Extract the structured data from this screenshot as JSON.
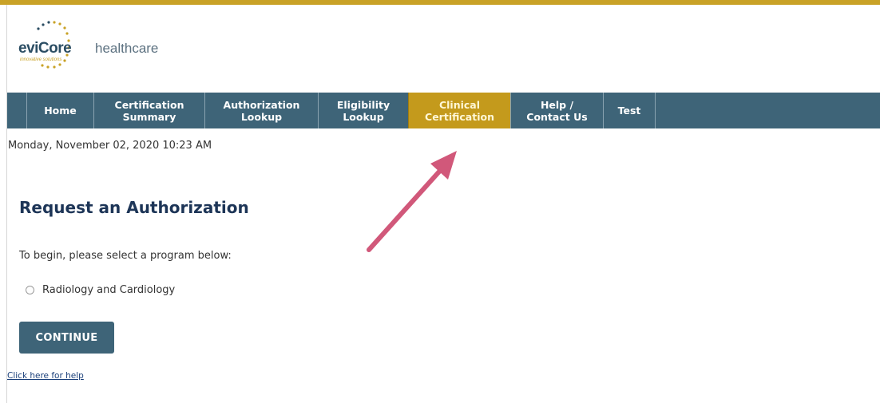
{
  "brand": {
    "logo_primary": "eviCore",
    "logo_tagline": "innovative solutions",
    "logo_secondary": "healthcare",
    "accent_color": "#c9a227",
    "nav_color": "#3e6478",
    "active_color": "#c49a1c"
  },
  "nav": {
    "items": [
      {
        "line1": "Home",
        "line2": ""
      },
      {
        "line1": "Certification",
        "line2": "Summary"
      },
      {
        "line1": "Authorization",
        "line2": "Lookup"
      },
      {
        "line1": "Eligibility",
        "line2": "Lookup"
      },
      {
        "line1": "Clinical",
        "line2": "Certification",
        "active": true
      },
      {
        "line1": "Help /",
        "line2": "Contact Us"
      },
      {
        "line1": "Test",
        "line2": ""
      }
    ]
  },
  "datetime": "Monday, November 02, 2020 10:23 AM",
  "page": {
    "title": "Request an Authorization",
    "instructions": "To begin, please select a program below:",
    "programs": [
      {
        "label": "Radiology and Cardiology",
        "selected": false
      }
    ],
    "continue_label": "CONTINUE",
    "help_link": "Click here for help"
  },
  "annotation": {
    "icon": "pointer-arrow-icon",
    "color": "#d1587a"
  }
}
